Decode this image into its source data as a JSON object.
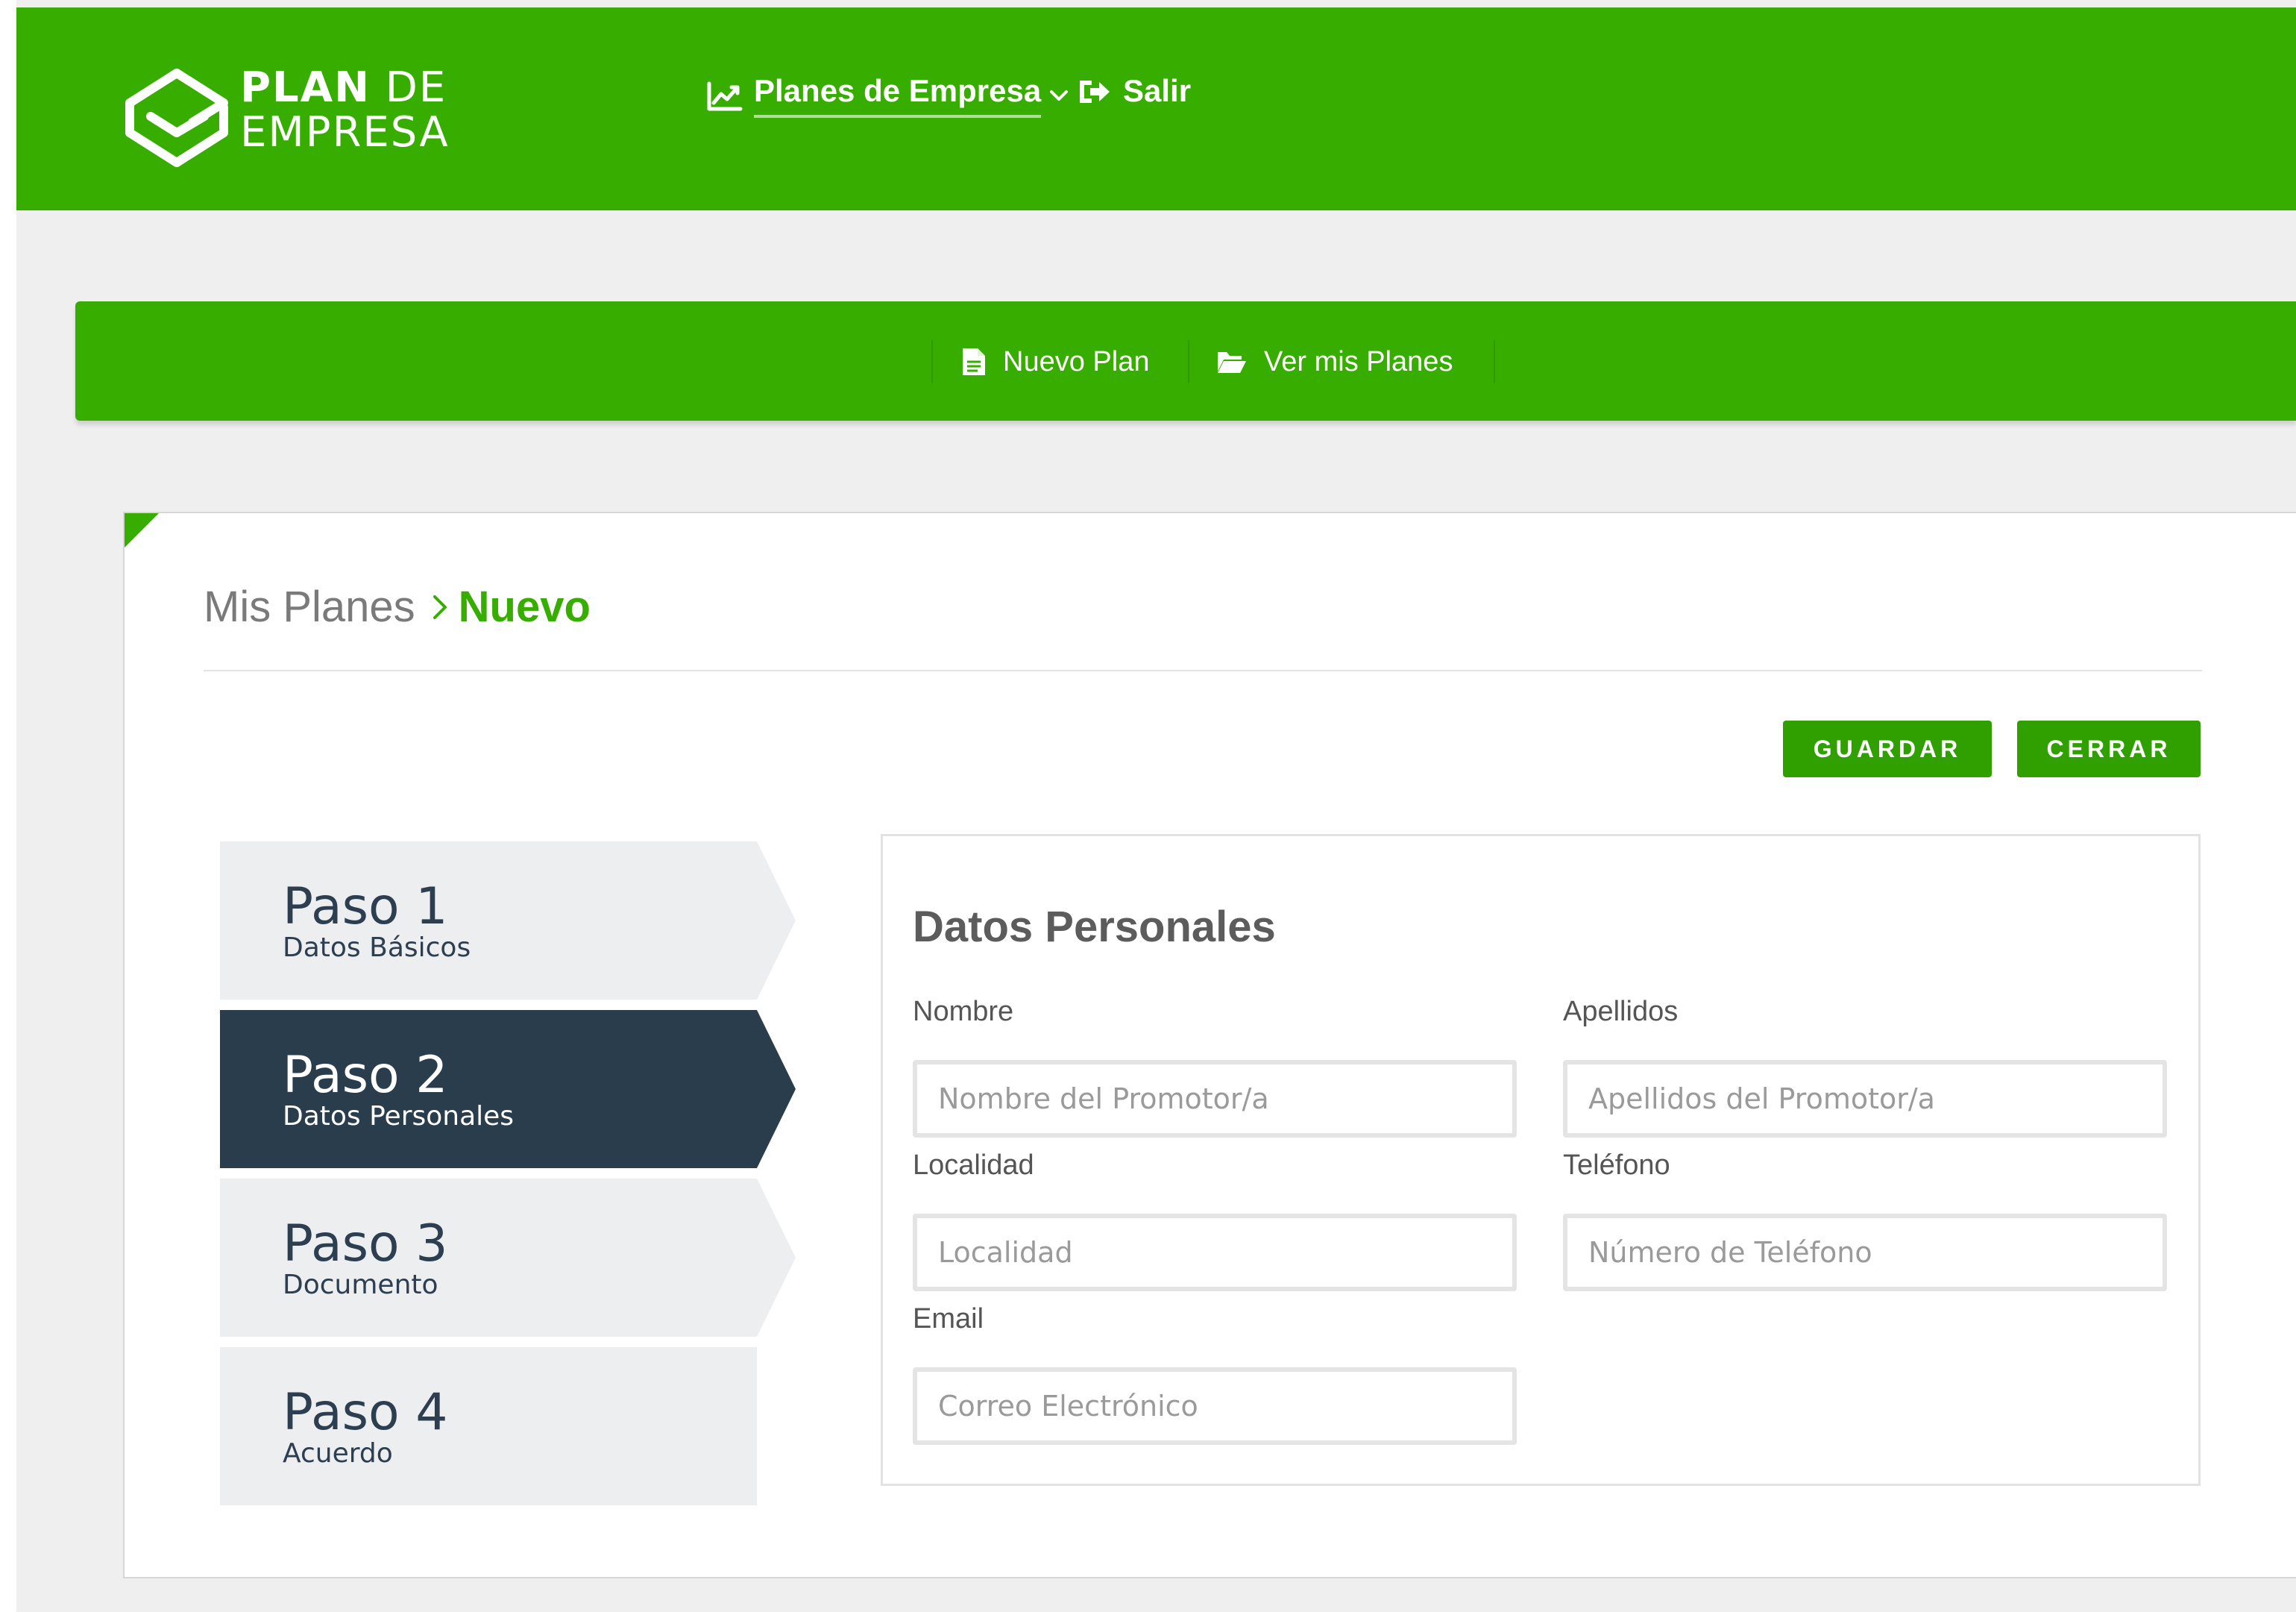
{
  "brand": {
    "line1_bold": "PLAN",
    "line1_light": "DE",
    "line2": "EMPRESA"
  },
  "topnav": {
    "planes_label": "Planes de Empresa",
    "salir_label": "Salir"
  },
  "subnav": {
    "nuevo_label": "Nuevo Plan",
    "ver_label": "Ver mis Planes"
  },
  "breadcrumb": {
    "home": "Mis Planes",
    "current": "Nuevo"
  },
  "actions": {
    "guardar": "GUARDAR",
    "cerrar": "CERRAR"
  },
  "steps": [
    {
      "title": "Paso 1",
      "subtitle": "Datos Básicos",
      "active": false
    },
    {
      "title": "Paso 2",
      "subtitle": "Datos Personales",
      "active": true
    },
    {
      "title": "Paso 3",
      "subtitle": "Documento",
      "active": false
    },
    {
      "title": "Paso 4",
      "subtitle": "Acuerdo",
      "active": false
    }
  ],
  "form": {
    "title": "Datos Personales",
    "nombre": {
      "label": "Nombre",
      "placeholder": "Nombre del Promotor/a",
      "value": ""
    },
    "apellidos": {
      "label": "Apellidos",
      "placeholder": "Apellidos del Promotor/a",
      "value": ""
    },
    "localidad": {
      "label": "Localidad",
      "placeholder": "Localidad",
      "value": ""
    },
    "telefono": {
      "label": "Teléfono",
      "placeholder": "Número de Teléfono",
      "value": ""
    },
    "email": {
      "label": "Email",
      "placeholder": "Correo Electrónico",
      "value": ""
    }
  },
  "colors": {
    "brand_green": "#37ad00",
    "button_green": "#2fa000",
    "active_step": "#2a3d4d",
    "inactive_step": "#eceef0"
  },
  "icons": [
    "logo-box-icon",
    "line-chart-icon",
    "chevron-down-icon",
    "sign-out-icon",
    "file-icon",
    "folder-open-icon",
    "chevron-right-icon"
  ]
}
